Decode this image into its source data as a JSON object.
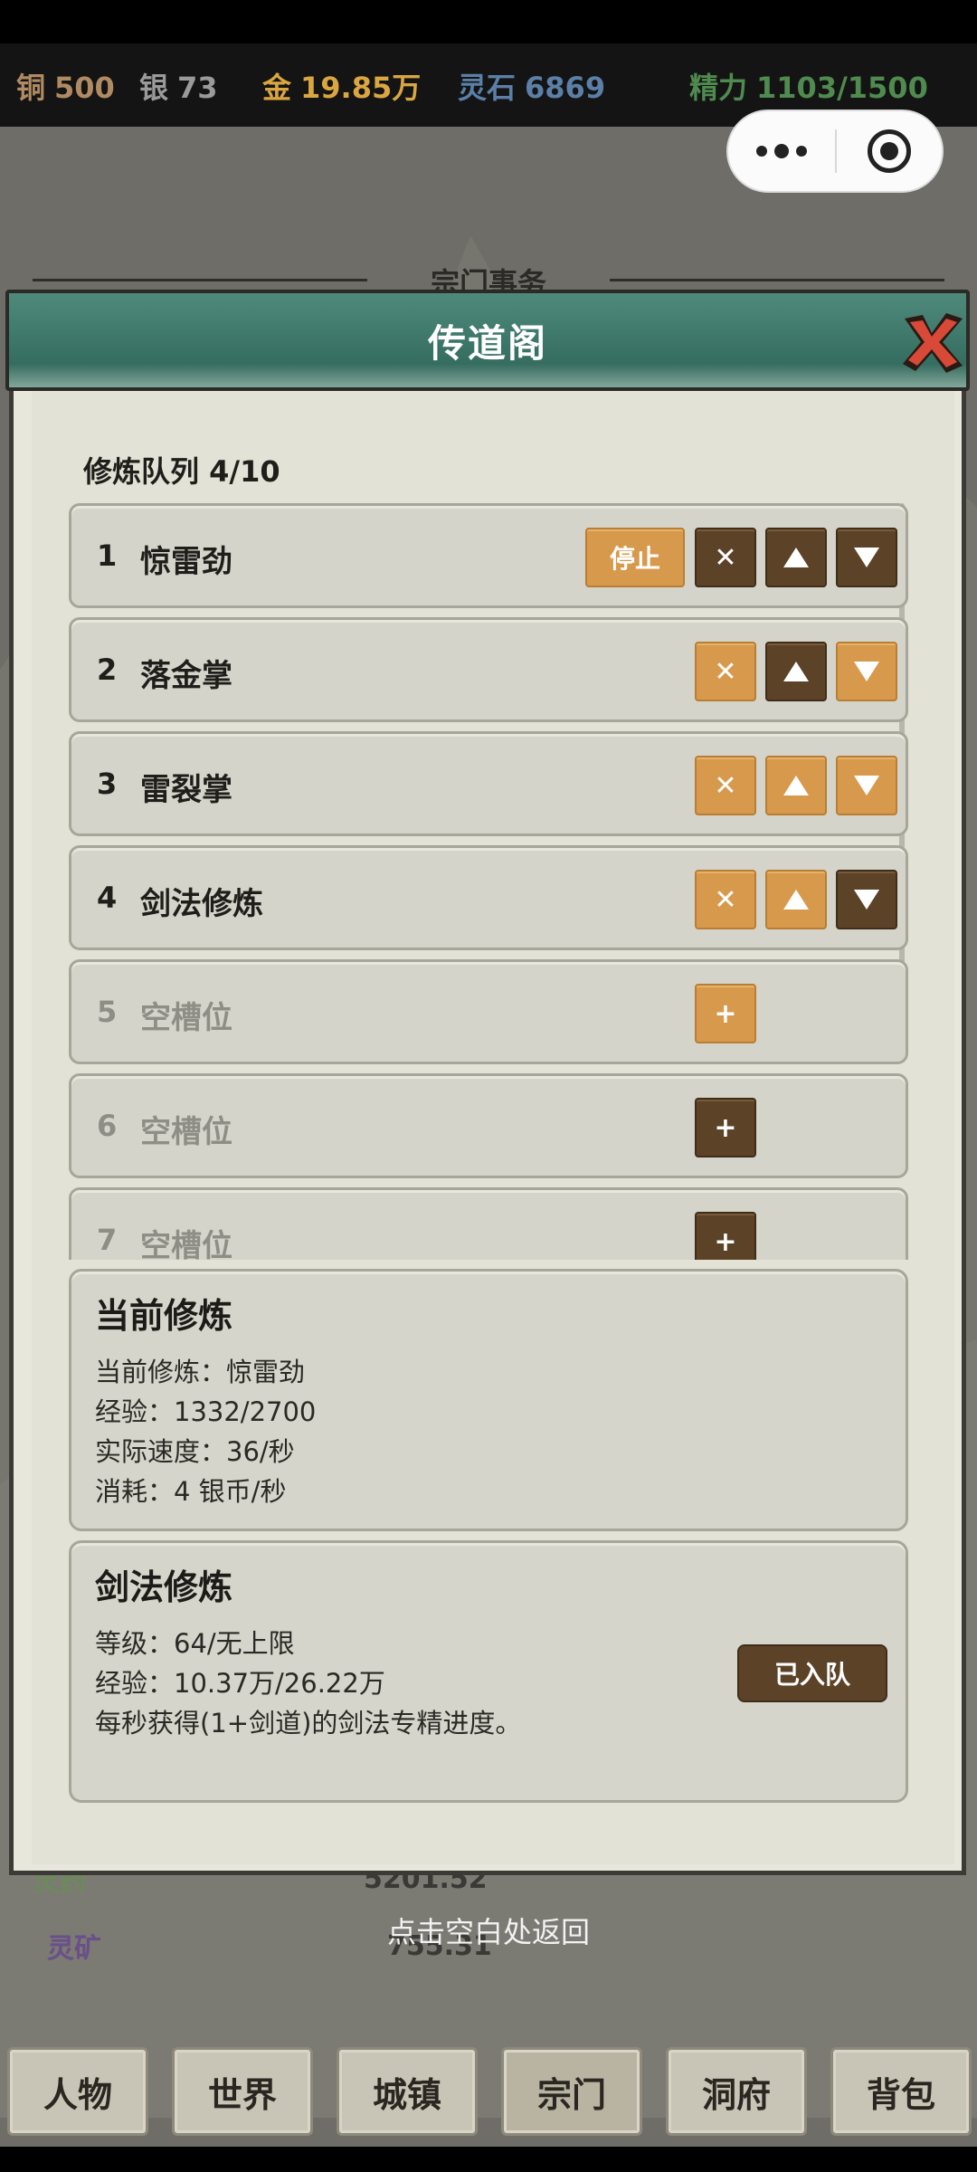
{
  "resources": [
    {
      "label": "铜",
      "value": "500",
      "color": "#b08a63"
    },
    {
      "label": "银",
      "value": "73",
      "color": "#9a9a9a"
    },
    {
      "label": "金",
      "value": "19.85万",
      "color": "#d9a640"
    },
    {
      "label": "灵石",
      "value": "6869",
      "color": "#5b7fa6"
    },
    {
      "label": "精力",
      "value": "1103/1500",
      "color": "#4f8a4f"
    }
  ],
  "modal": {
    "section": "宗门事务",
    "title": "传道阁"
  },
  "queue": {
    "title": "修炼队列 4/10",
    "stop_label": "停止",
    "remove_glyph": "✕",
    "add_glyph": "+",
    "items": [
      {
        "num": "1",
        "name": "惊雷劲"
      },
      {
        "num": "2",
        "name": "落金掌"
      },
      {
        "num": "3",
        "name": "雷裂掌"
      },
      {
        "num": "4",
        "name": "剑法修炼"
      },
      {
        "num": "5",
        "name": "空槽位"
      },
      {
        "num": "6",
        "name": "空槽位"
      },
      {
        "num": "7",
        "name": "空槽位"
      }
    ]
  },
  "current": {
    "title": "当前修炼",
    "lines": [
      "当前修炼：惊雷劲",
      "经验：1332/2700",
      "实际速度：36/秒",
      "消耗：4 银币/秒"
    ]
  },
  "skill": {
    "title": "剑法修炼",
    "lines": [
      "等级：64/无上限",
      "经验：10.37万/26.22万",
      "每秒获得(1+剑道)的剑法专精进度。"
    ],
    "button": "已入队"
  },
  "background": {
    "rows": [
      {
        "label": "灵药",
        "value": "5201.52"
      },
      {
        "label": "灵矿",
        "value": "755.31"
      }
    ],
    "hint": "点击空白处返回"
  },
  "nav": [
    "人物",
    "世界",
    "城镇",
    "宗门",
    "洞府",
    "背包"
  ]
}
